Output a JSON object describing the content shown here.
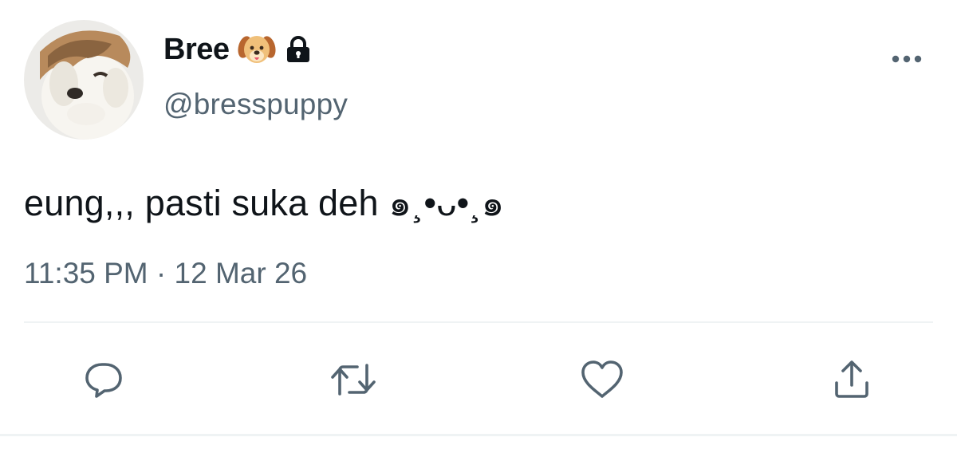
{
  "user": {
    "display_name": "Bree",
    "name_emoji": "dog-face-emoji",
    "protected_icon": "lock-icon",
    "handle": "@bresspuppy"
  },
  "tweet": {
    "text": "eung,,, pasti suka deh ๑¸•ᴗ•¸๑",
    "time": "11:35 PM",
    "separator": "·",
    "date": "12 Mar 26"
  },
  "actions": {
    "reply_icon": "reply-icon",
    "retweet_icon": "retweet-icon",
    "like_icon": "heart-icon",
    "share_icon": "share-icon"
  },
  "colors": {
    "text": "#0f1419",
    "secondary": "#536471",
    "divider": "#eff3f4"
  }
}
